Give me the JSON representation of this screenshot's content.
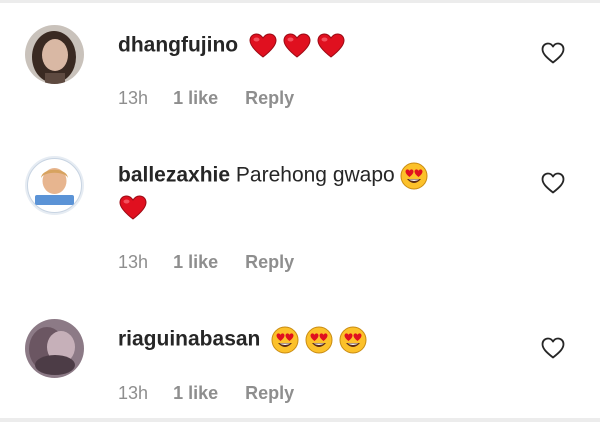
{
  "comments": [
    {
      "username": "dhangfujino",
      "text": "",
      "emojis_inline": [
        "red-heart",
        "red-heart",
        "red-heart"
      ],
      "emojis_second_line": [],
      "time": "13h",
      "likes": "1 like",
      "reply": "Reply"
    },
    {
      "username": "ballezaxhie",
      "text": "Parehong gwapo",
      "emojis_inline": [
        "heart-eyes"
      ],
      "emojis_second_line": [
        "red-heart"
      ],
      "time": "13h",
      "likes": "1 like",
      "reply": "Reply"
    },
    {
      "username": "riaguinabasan",
      "text": "",
      "emojis_inline": [
        "heart-eyes",
        "heart-eyes",
        "heart-eyes"
      ],
      "emojis_second_line": [],
      "time": "13h",
      "likes": "1 like",
      "reply": "Reply"
    }
  ],
  "icons": {
    "like_button": "heart-outline-icon",
    "emoji_heart": "red-heart-emoji",
    "emoji_heart_eyes": "heart-eyes-emoji"
  },
  "colors": {
    "text": "#262626",
    "meta": "#8e8e8e",
    "heart": "#e0101f",
    "emoji_face": "#fcc12a"
  }
}
